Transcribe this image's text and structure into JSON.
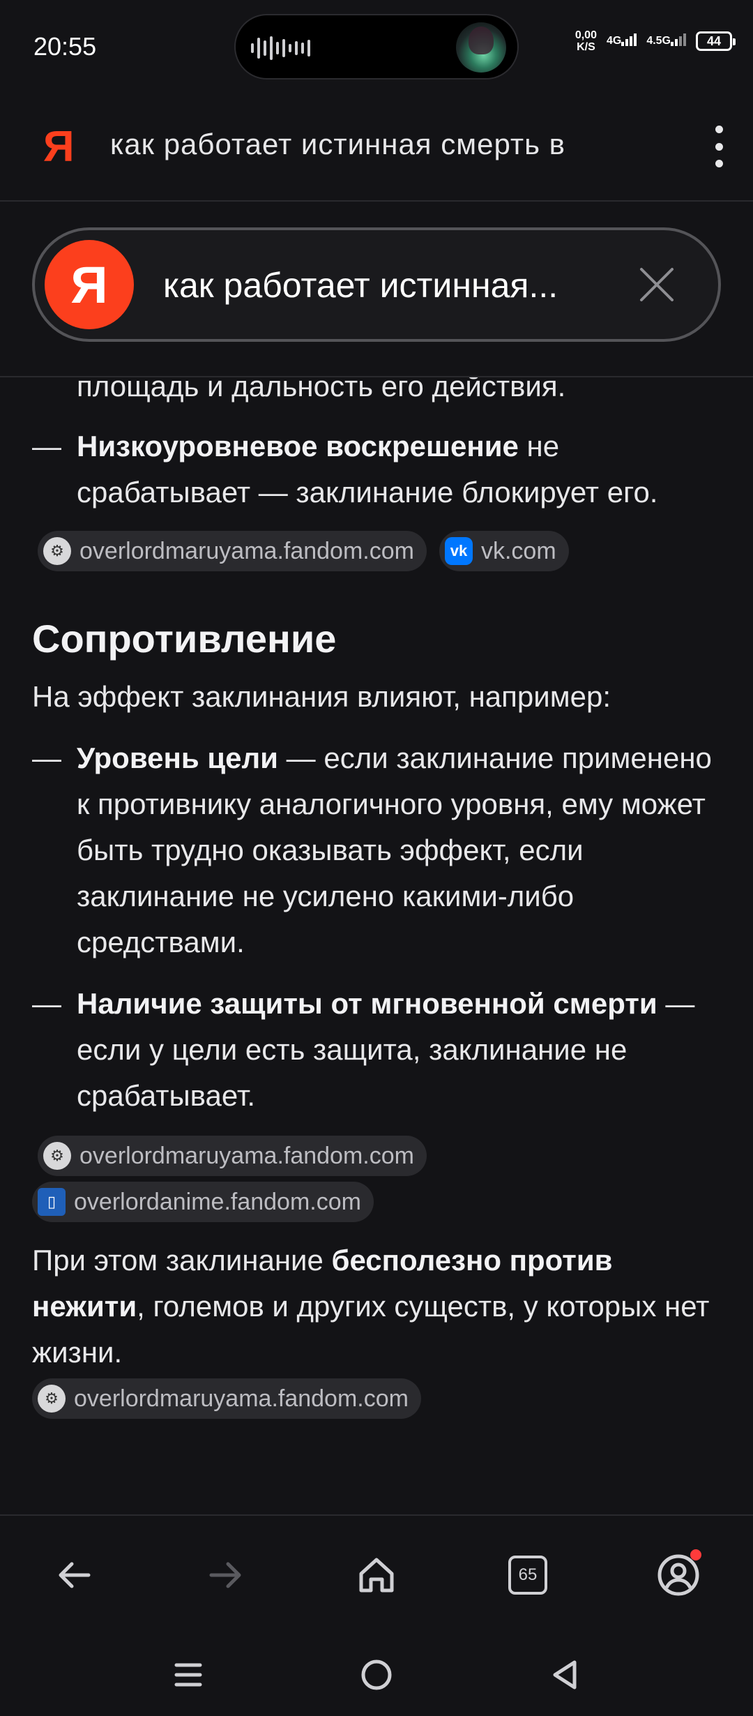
{
  "status_bar": {
    "time": "20:55",
    "net_speed_value": "0,00",
    "net_speed_unit": "K/S",
    "network_1": "4G",
    "network_2": "4.5G",
    "battery": "44"
  },
  "toolbar": {
    "logo": "Я",
    "query": "как работает истинная смерть в"
  },
  "search_pill": {
    "logo": "Я",
    "query": "как работает истинная..."
  },
  "content": {
    "intro_tail": "площадь и дальность его действия.",
    "bullet_low_revive": {
      "bold": "Низкоуровневое воскрешение",
      "text": " не срабатывает — заклинание блокирует его."
    },
    "sources_1": [
      {
        "icon": "fandom",
        "label": "overlordmaruyama.fandom.com"
      },
      {
        "icon": "vk",
        "label": "vk.com"
      }
    ],
    "section_title": "Сопротивление",
    "section_intro": "На эффект заклинания влияют, например:",
    "bullet_level": {
      "bold": "Уровень цели",
      "text": " — если заклинание применено к противнику аналогичного уровня, ему может быть трудно оказывать эффект, если заклинание не усилено какими-либо средствами."
    },
    "bullet_protection": {
      "bold": "Наличие защиты от мгновенной смерти",
      "text": " — если у цели есть защита, заклинание не срабатывает."
    },
    "sources_2": [
      {
        "icon": "fandom",
        "label": "overlordmaruyama.fandom.com"
      },
      {
        "icon": "anime",
        "label": "overlordanime.fandom.com"
      }
    ],
    "final_para": {
      "pre": "При этом заклинание ",
      "bold": "бесполезно против нежити",
      "post": ", големов и других существ, у которых нет жизни."
    },
    "sources_3": [
      {
        "icon": "fandom",
        "label": "overlordmaruyama.fandom.com"
      }
    ]
  },
  "bottom_nav": {
    "tab_count": "65"
  },
  "icons": {
    "back": "back-arrow-icon",
    "forward": "forward-arrow-icon",
    "home": "home-icon",
    "tabs": "tabs-icon",
    "profile": "profile-icon",
    "close": "close-icon",
    "menu": "more-vertical-icon"
  },
  "colors": {
    "background": "#131316",
    "yandex_red": "#fc3f1d",
    "chip_bg": "#2a2a2e",
    "text": "#e8e8ea"
  }
}
